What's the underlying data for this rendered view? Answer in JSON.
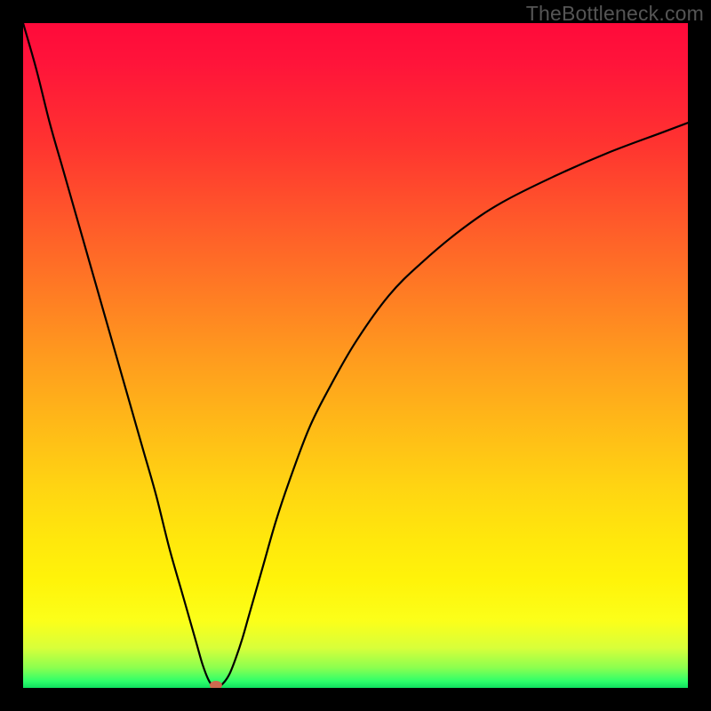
{
  "watermark": "TheBottleneck.com",
  "colors": {
    "frame": "#000000",
    "curve": "#000000",
    "marker": "#cc6a4f",
    "gradient_top": "#ff0a3a",
    "gradient_bottom": "#10e060"
  },
  "chart_data": {
    "type": "line",
    "title": "",
    "xlabel": "",
    "ylabel": "",
    "xlim": [
      0,
      100
    ],
    "ylim": [
      0,
      100
    ],
    "grid": false,
    "legend": false,
    "series": [
      {
        "name": "bottleneck-curve",
        "x": [
          0,
          2,
          4,
          6,
          8,
          10,
          12,
          14,
          16,
          18,
          20,
          22,
          24,
          26,
          27,
          28,
          29,
          30,
          31,
          32,
          33,
          34,
          36,
          38,
          40,
          43,
          46,
          50,
          55,
          60,
          66,
          72,
          80,
          88,
          96,
          100
        ],
        "y": [
          100,
          93,
          85,
          78,
          71,
          64,
          57,
          50,
          43,
          36,
          29,
          21,
          14,
          7,
          3.5,
          1,
          0,
          0.6,
          2,
          4.5,
          7.5,
          11,
          18,
          25,
          31,
          39,
          45,
          52,
          59,
          64,
          69,
          73,
          77,
          80.5,
          83.5,
          85
        ]
      }
    ],
    "annotations": [
      {
        "name": "optimal-point",
        "x": 29,
        "y": 0,
        "shape": "ellipse"
      }
    ]
  }
}
